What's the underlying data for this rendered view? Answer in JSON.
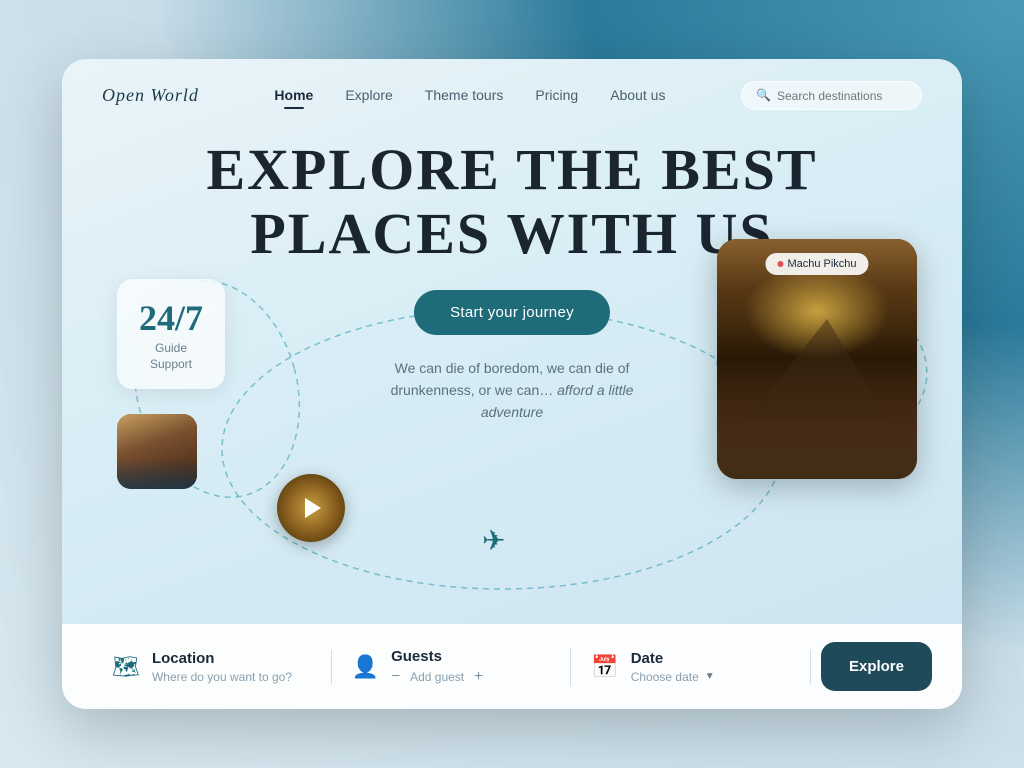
{
  "brand": {
    "name": "Open World"
  },
  "nav": {
    "links": [
      {
        "id": "home",
        "label": "Home",
        "active": true
      },
      {
        "id": "explore",
        "label": "Explore",
        "active": false
      },
      {
        "id": "theme-tours",
        "label": "Theme tours",
        "active": false
      },
      {
        "id": "pricing",
        "label": "Pricing",
        "active": false
      },
      {
        "id": "about",
        "label": "About us",
        "active": false
      }
    ],
    "search_placeholder": "Search destinations"
  },
  "hero": {
    "title_line1": "EXPLORE THE BEST",
    "title_line2": "PLACES WITH US",
    "cta_label": "Start your journey",
    "subtitle": "We can die of boredom, we can die of drunkenness, or we can…",
    "subtitle_italic": "afford a little adventure"
  },
  "card_247": {
    "number": "24/7",
    "label1": "Guide",
    "label2": "Support"
  },
  "machu_card": {
    "location_label": "Machu Pikchu"
  },
  "booking_bar": {
    "location_label": "Location",
    "location_placeholder": "Where do you want to go?",
    "guests_label": "Guests",
    "guests_placeholder": "Add guest",
    "date_label": "Date",
    "date_placeholder": "Choose date",
    "explore_button": "Explore"
  }
}
